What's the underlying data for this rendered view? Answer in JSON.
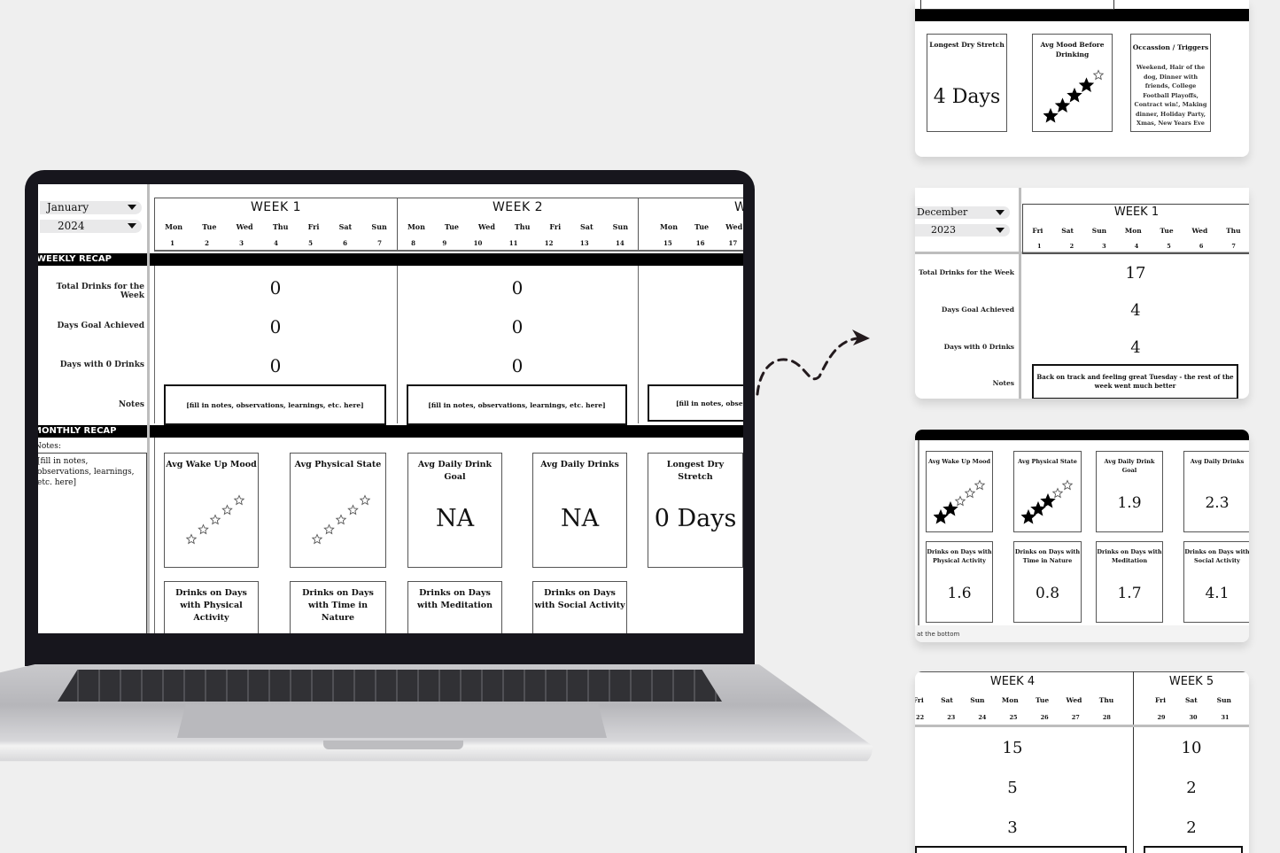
{
  "main_sheet": {
    "month_select": "January",
    "year_select": "2024",
    "weeks": [
      {
        "title": "WEEK 1",
        "days": [
          "Mon",
          "Tue",
          "Wed",
          "Thu",
          "Fri",
          "Sat",
          "Sun"
        ],
        "dates": [
          "1",
          "2",
          "3",
          "4",
          "5",
          "6",
          "7"
        ],
        "total_drinks": "0",
        "days_goal_achieved": "0",
        "days_zero_drinks": "0",
        "notes": "[fill in notes, observations, learnings, etc. here]"
      },
      {
        "title": "WEEK 2",
        "days": [
          "Mon",
          "Tue",
          "Wed",
          "Thu",
          "Fri",
          "Sat",
          "Sun"
        ],
        "dates": [
          "8",
          "9",
          "10",
          "11",
          "12",
          "13",
          "14"
        ],
        "total_drinks": "0",
        "days_goal_achieved": "0",
        "days_zero_drinks": "0",
        "notes": "[fill in notes, observations, learnings, etc. here]"
      },
      {
        "title": "W",
        "days": [
          "Mon",
          "Tue",
          "Wed"
        ],
        "dates": [
          "15",
          "16",
          "17"
        ],
        "notes": "[fill in notes, observ"
      }
    ],
    "weekly_recap_label": "WEEKLY RECAP",
    "row_labels": {
      "total_drinks": "Total Drinks for the Week",
      "days_goal": "Days Goal Achieved",
      "days_zero": "Days with 0 Drinks",
      "notes": "Notes"
    },
    "monthly_recap_label": "MONTHLY RECAP",
    "monthly_notes_label": "Notes:",
    "monthly_notes_value": "[fill in notes, observations, learnings, etc. here]",
    "cards_row1": [
      {
        "title": "Avg Wake Up Mood",
        "rating": 0,
        "max": 5
      },
      {
        "title": "Avg Physical State",
        "rating": 0,
        "max": 5
      },
      {
        "title": "Avg Daily Drink Goal",
        "value": "NA"
      },
      {
        "title": "Avg Daily Drinks",
        "value": "NA"
      },
      {
        "title": "Longest Dry Stretch",
        "value": "0 Days"
      }
    ],
    "cards_row2": [
      {
        "title": "Drinks on Days with Physical Activity"
      },
      {
        "title": "Drinks on Days with Time in Nature"
      },
      {
        "title": "Drinks on Days with Meditation"
      },
      {
        "title": "Drinks on Days with Social Activity"
      }
    ]
  },
  "preview_1": {
    "cards": [
      {
        "title": "Longest Dry Stretch",
        "value": "4 Days"
      },
      {
        "title": "Avg Mood Before Drinking",
        "rating": 4,
        "max": 5
      },
      {
        "title": "Occassion / Triggers",
        "value": "Weekend, Hair of the dog, Dinner with friends, College Football Playoffs, Contract win!, Making dinner, Holiday Party, Xmas, New Years Eve"
      }
    ]
  },
  "preview_2": {
    "month_select": "December",
    "year_select": "2023",
    "week": {
      "title": "WEEK 1",
      "days": [
        "Fri",
        "Sat",
        "Sun",
        "Mon",
        "Tue",
        "Wed",
        "Thu"
      ],
      "dates": [
        "1",
        "2",
        "3",
        "4",
        "5",
        "6",
        "7"
      ]
    },
    "row_labels": [
      "Total Drinks for the Week",
      "Days Goal Achieved",
      "Days with 0 Drinks",
      "Notes"
    ],
    "values": [
      "17",
      "4",
      "4"
    ],
    "notes": "Back on track and feeling great Tuesday - the rest of the week went much better"
  },
  "preview_3": {
    "cards": [
      {
        "title": "Avg Wake Up Mood",
        "rating": 2,
        "max": 5
      },
      {
        "title": "Avg Physical State",
        "rating": 3,
        "max": 5
      },
      {
        "title": "Avg Daily Drink Goal",
        "value": "1.9"
      },
      {
        "title": "Avg Daily Drinks",
        "value": "2.3"
      },
      {
        "title": "Drinks on Days with Physical Activity",
        "value": "1.6"
      },
      {
        "title": "Drinks on Days with Time in Nature",
        "value": "0.8"
      },
      {
        "title": "Drinks on Days with Meditation",
        "value": "1.7"
      },
      {
        "title": "Drinks on Days with Social Activity",
        "value": "4.1"
      }
    ],
    "footer_text": "at the bottom"
  },
  "preview_4": {
    "weeks": [
      {
        "title": "WEEK 4",
        "days": [
          "Fri",
          "Sat",
          "Sun",
          "Mon",
          "Tue",
          "Wed",
          "Thu"
        ],
        "dates": [
          "22",
          "23",
          "24",
          "25",
          "26",
          "27",
          "28"
        ],
        "values": [
          "15",
          "5",
          "3"
        ]
      },
      {
        "title": "WEEK 5",
        "days": [
          "Fri",
          "Sat",
          "Sun"
        ],
        "dates": [
          "29",
          "30",
          "31"
        ],
        "values": [
          "10",
          "2",
          "2"
        ]
      }
    ]
  },
  "colors": {
    "background": "#efefef",
    "laptop_bezel": "#17161d",
    "recap_bar": "#000000",
    "dropdown_bg": "#e9e9ea"
  }
}
